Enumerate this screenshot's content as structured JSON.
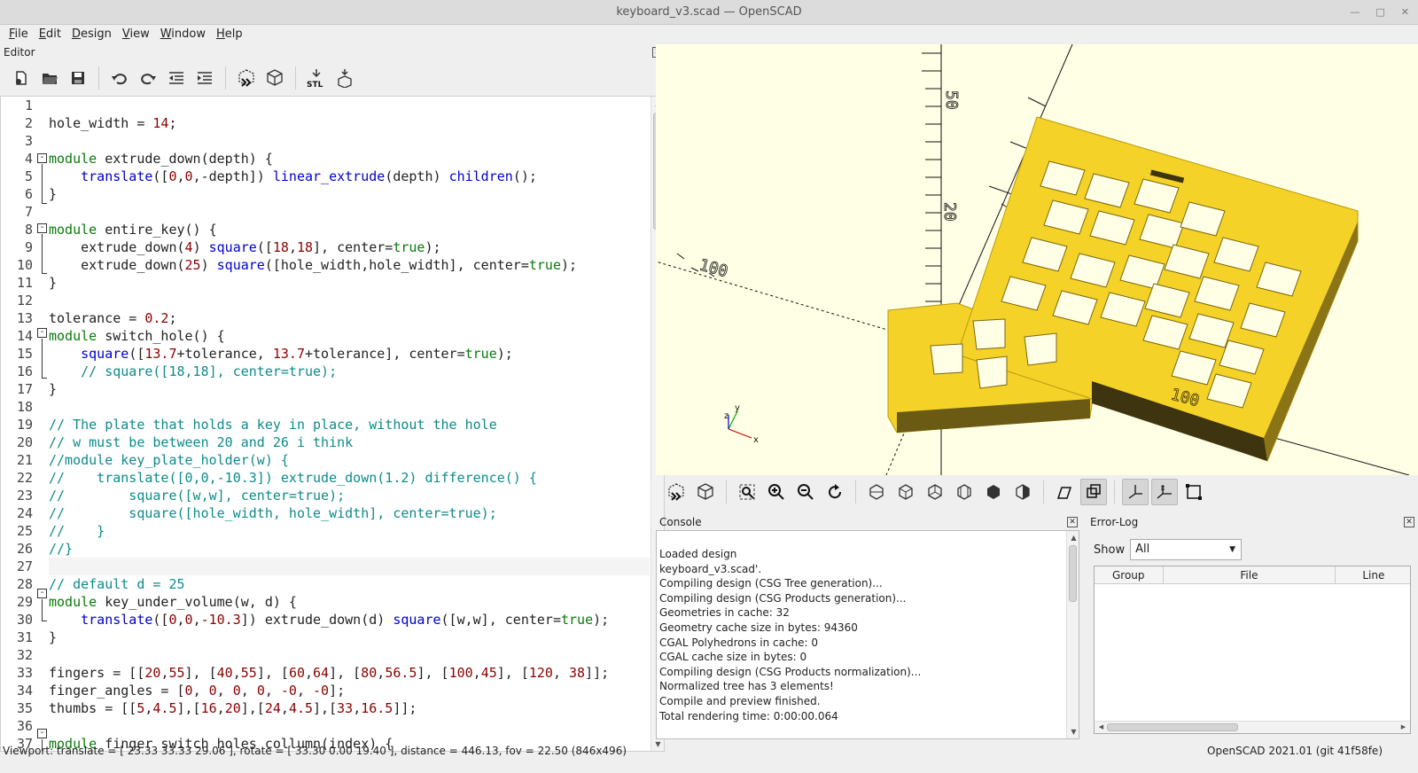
{
  "window": {
    "title": "keyboard_v3.scad — OpenSCAD"
  },
  "menu": [
    "File",
    "Edit",
    "Design",
    "View",
    "Window",
    "Help"
  ],
  "editor": {
    "title": "Editor",
    "toolbar": [
      "new-icon",
      "open-icon",
      "save-icon",
      "undo-icon",
      "redo-icon",
      "unindent-icon",
      "indent-icon",
      "preview-icon",
      "render-icon",
      "export-stl-icon",
      "send-to-print-icon"
    ],
    "stl_label": "STL",
    "line_numbers": [
      "1",
      "2",
      "3",
      "4",
      "5",
      "6",
      "7",
      "8",
      "9",
      "10",
      "11",
      "12",
      "13",
      "14",
      "15",
      "16",
      "17",
      "18",
      "19",
      "20",
      "21",
      "22",
      "23",
      "24",
      "25",
      "26",
      "27",
      "28",
      "29",
      "30",
      "31",
      "32",
      "33",
      "34",
      "35",
      "36",
      "37"
    ]
  },
  "code_lines": [
    "",
    "hole_width = 14;",
    "",
    "module extrude_down(depth) {",
    "    translate([0,0,-depth]) linear_extrude(depth) children();",
    "}",
    "",
    "module entire_key() {",
    "    extrude_down(4) square([18,18], center=true);",
    "    extrude_down(25) square([hole_width,hole_width], center=true);",
    "}",
    "",
    "tolerance = 0.2;",
    "module switch_hole() {",
    "    square([13.7+tolerance, 13.7+tolerance], center=true);",
    "    // square([18,18], center=true);",
    "}",
    "",
    "// The plate that holds a key in place, without the hole",
    "// w must be between 20 and 26 i think",
    "//module key_plate_holder(w) {",
    "//    translate([0,0,-10.3]) extrude_down(1.2) difference() {",
    "//        square([w,w], center=true);",
    "//        square([hole_width, hole_width], center=true);",
    "//    }",
    "//}",
    "",
    "// default d = 25",
    "module key_under_volume(w, d) {",
    "    translate([0,0,-10.3]) extrude_down(d) square([w,w], center=true);",
    "}",
    "",
    "fingers = [[20,55], [40,55], [60,64], [80,56.5], [100,45], [120, 38]];",
    "finger_angles = [0, 0, 0, 0, -0, -0];",
    "thumbs = [[5,4.5],[16,20],[24,4.5],[33,16.5]];",
    "",
    "module finger_switch_holes_collumn(index) {"
  ],
  "viewport": {
    "axis_labels": {
      "z": "z",
      "y": "y",
      "x": "x"
    },
    "scale_marks": [
      "100",
      "50",
      "20",
      "100"
    ],
    "colors": {
      "background": "#ffffe5",
      "model": "#f5d227",
      "model_dark": "#5a4a10"
    }
  },
  "view_toolbar": [
    "preview-icon",
    "render-icon",
    "view-all-icon",
    "zoom-in-icon",
    "zoom-out-icon",
    "reset-view-icon",
    "view-right-icon",
    "view-top-icon",
    "view-bottom-icon",
    "view-left-icon",
    "view-front-icon",
    "view-back-icon",
    "perspective-icon",
    "orthogonal-icon",
    "show-axes-icon",
    "show-scale-icon",
    "show-edges-icon"
  ],
  "console": {
    "title": "Console",
    "lines": [
      "Loaded design",
      "keyboard_v3.scad'.",
      "Compiling design (CSG Tree generation)...",
      "Compiling design (CSG Products generation)...",
      "Geometries in cache: 32",
      "Geometry cache size in bytes: 94360",
      "CGAL Polyhedrons in cache: 0",
      "CGAL cache size in bytes: 0",
      "Compiling design (CSG Products normalization)...",
      "Normalized tree has 3 elements!",
      "Compile and preview finished.",
      "Total rendering time: 0:00:00.064"
    ]
  },
  "error_log": {
    "title": "Error-Log",
    "show_label": "Show",
    "show_value": "All",
    "columns": [
      "Group",
      "File",
      "Line"
    ]
  },
  "status": {
    "viewport": "Viewport: translate = [ 23.33 33.33 29.06 ], rotate = [ 33.30 0.00 19.40 ], distance = 446.13, fov = 22.50 (846x496)",
    "version": "OpenSCAD 2021.01 (git 41f58fe)"
  }
}
